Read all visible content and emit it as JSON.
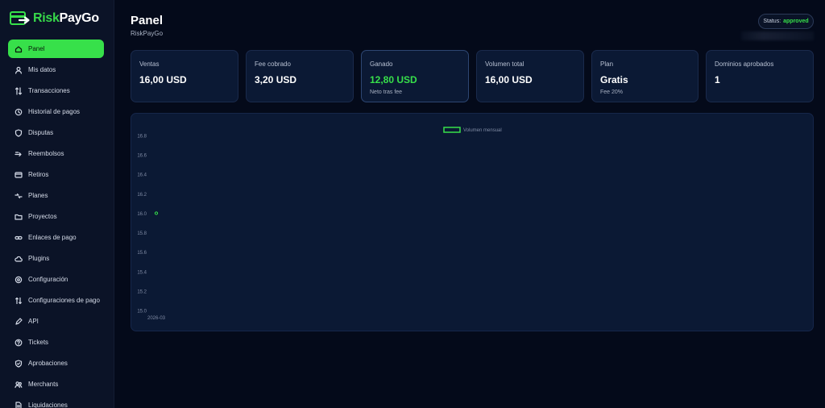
{
  "brand": {
    "name_part1": "Risk",
    "name_part2": "PayGo"
  },
  "sidebar": {
    "items": [
      {
        "label": "Panel",
        "icon": "home-icon",
        "active": true
      },
      {
        "label": "Mis datos",
        "icon": "user-icon"
      },
      {
        "label": "Transacciones",
        "icon": "transfer-icon"
      },
      {
        "label": "Historial de pagos",
        "icon": "history-icon"
      },
      {
        "label": "Disputas",
        "icon": "shield-icon"
      },
      {
        "label": "Reembolsos",
        "icon": "refund-icon"
      },
      {
        "label": "Retiros",
        "icon": "card-icon"
      },
      {
        "label": "Planes",
        "icon": "plans-icon"
      },
      {
        "label": "Proyectos",
        "icon": "folder-icon"
      },
      {
        "label": "Enlaces de pago",
        "icon": "link-icon"
      },
      {
        "label": "Plugins",
        "icon": "cloud-icon"
      },
      {
        "label": "Configuración",
        "icon": "settings-icon"
      },
      {
        "label": "Configuraciones de pago",
        "icon": "sort-icon"
      },
      {
        "label": "API",
        "icon": "pen-icon"
      },
      {
        "label": "Tickets",
        "icon": "help-icon"
      },
      {
        "label": "Aprobaciones",
        "icon": "check-icon"
      },
      {
        "label": "Merchants",
        "icon": "users-icon"
      },
      {
        "label": "Liquidaciones",
        "icon": "document-icon"
      }
    ]
  },
  "header": {
    "title": "Panel",
    "subtitle": "RiskPayGo",
    "status_label": "Status:",
    "status_value": "approved"
  },
  "colors": {
    "accent": "#37e04a",
    "background": "#040a1a",
    "card": "#0b1934"
  },
  "stats": [
    {
      "label": "Ventas",
      "value": "16,00 USD"
    },
    {
      "label": "Fee cobrado",
      "value": "3,20 USD"
    },
    {
      "label": "Ganado",
      "value": "12,80 USD",
      "note": "Neto tras fee"
    },
    {
      "label": "Volumen total",
      "value": "16,00 USD"
    },
    {
      "label": "Plan",
      "value": "Gratis",
      "note": "Fee 20%"
    },
    {
      "label": "Dominios aprobados",
      "value": "1"
    }
  ],
  "chart_data": {
    "type": "line",
    "x": [
      "2026-03"
    ],
    "series": [
      {
        "name": "Volumen mensual",
        "values": [
          16
        ],
        "color": "#37e04a"
      }
    ],
    "ylim": [
      15,
      16.8
    ],
    "yticks": [
      "16.8",
      "16.6",
      "16.4",
      "16.2",
      "16.0",
      "15.8",
      "15.6",
      "15.4",
      "15.2",
      "15.0"
    ],
    "legend": "top-center",
    "grid": false
  }
}
